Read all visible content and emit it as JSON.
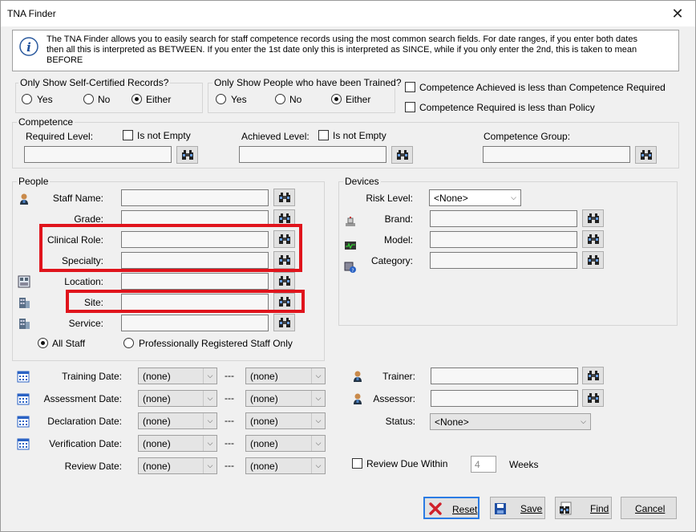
{
  "window": {
    "title": "TNA Finder",
    "close_symbol": "✕"
  },
  "info": {
    "line1": "The TNA Finder allows you to easily search for staff competence records using the most common search fields. For date ranges, if you enter both dates",
    "line2": "then all this is interpreted as BETWEEN. If you enter the 1st date only this is interpreted as SINCE, while if you only enter the 2nd, this is taken to mean",
    "line3": "BEFORE"
  },
  "self_certified": {
    "label": "Only Show Self-Certified Records?",
    "options": [
      "Yes",
      "No",
      "Either"
    ],
    "selected": "Either"
  },
  "trained": {
    "label": "Only Show People who have been Trained?",
    "options": [
      "Yes",
      "No",
      "Either"
    ],
    "selected": "Either"
  },
  "flags": {
    "achieved_less": "Competence Achieved is less than Competence Required",
    "required_less": "Competence Required is less than Policy"
  },
  "competence": {
    "title": "Competence",
    "required_level": "Required Level:",
    "achieved_level": "Achieved Level:",
    "is_not_empty": "Is not Empty",
    "group": "Competence Group:"
  },
  "people": {
    "title": "People",
    "staff_name": "Staff Name:",
    "grade": "Grade:",
    "clinical_role": "Clinical Role:",
    "specialty": "Specialty:",
    "location": "Location:",
    "site": "Site:",
    "service": "Service:",
    "all_staff": "All Staff",
    "registered": "Professionally Registered Staff Only",
    "staff_selected": "All Staff"
  },
  "devices": {
    "title": "Devices",
    "risk_level": "Risk Level:",
    "risk_value": "<None>",
    "brand": "Brand:",
    "model": "Model:",
    "category": "Category:"
  },
  "dates": {
    "rows": [
      {
        "label": "Training Date:",
        "from": "(none)",
        "to": "(none)"
      },
      {
        "label": "Assessment  Date:",
        "from": "(none)",
        "to": "(none)"
      },
      {
        "label": "Declaration Date:",
        "from": "(none)",
        "to": "(none)"
      },
      {
        "label": "Verification Date:",
        "from": "(none)",
        "to": "(none)"
      },
      {
        "label": "Review Date:",
        "from": "(none)",
        "to": "(none)"
      }
    ],
    "separator": "---"
  },
  "review": {
    "trainer": "Trainer:",
    "assessor": "Assessor:",
    "status": "Status:",
    "status_value": "<None>",
    "review_due": "Review Due Within",
    "weeks_value": "4",
    "weeks": "Weeks"
  },
  "buttons": {
    "reset": "Reset",
    "save": "Save",
    "find": "Find",
    "cancel": "Cancel"
  },
  "colors": {
    "highlight": "#e0141c",
    "accent": "#2a7be4"
  }
}
